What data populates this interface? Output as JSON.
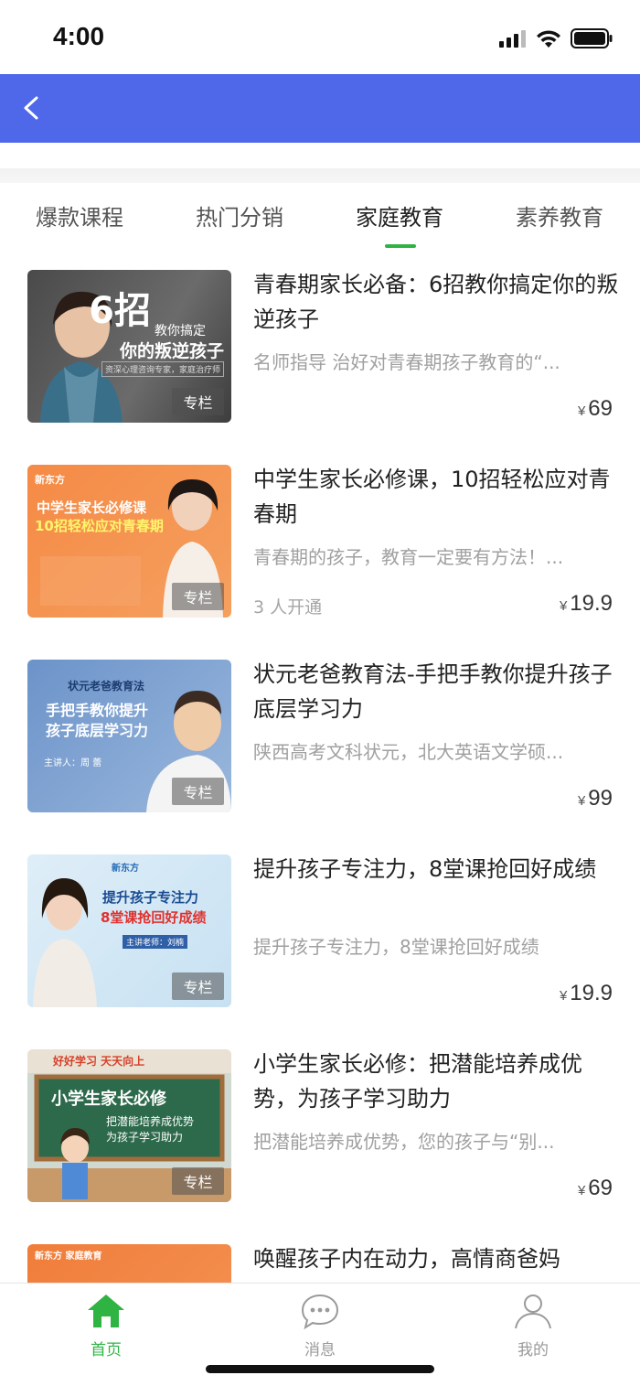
{
  "status": {
    "time": "4:00"
  },
  "tabs": [
    {
      "label": "爆款课程",
      "active": false
    },
    {
      "label": "热门分销",
      "active": false
    },
    {
      "label": "家庭教育",
      "active": true
    },
    {
      "label": "素养教育",
      "active": false
    }
  ],
  "courses": [
    {
      "title": "青春期家长必备：6招教你搞定你的叛逆孩子",
      "desc": "名师指导 治好对青春期孩子教育的“...",
      "price_symbol": "¥",
      "price": "69",
      "badge": "专栏",
      "thumb": {
        "big": "6招",
        "line1": "教你搞定",
        "line2": "你的叛逆孩子",
        "note": "资深心理咨询专家，家庭治疗师"
      }
    },
    {
      "title": "中学生家长必修课，10招轻松应对青春期",
      "desc": "青春期的孩子，教育一定要有方法！...",
      "subscribers": "3 人开通",
      "price_symbol": "¥",
      "price": "19.9",
      "badge": "专栏",
      "thumb": {
        "brand": "新东方",
        "line1": "中学生家长必修课",
        "line2": "10招轻松应对青春期"
      }
    },
    {
      "title": "状元老爸教育法-手把手教你提升孩子底层学习力",
      "desc": "陕西高考文科状元，北大英语文学硕...",
      "price_symbol": "¥",
      "price": "99",
      "badge": "专栏",
      "thumb": {
        "small": "状元老爸教育法",
        "line1": "手把手教你提升",
        "line2": "孩子底层学习力",
        "speaker": "主讲人：周 蕾"
      }
    },
    {
      "title": "提升孩子专注力，8堂课抢回好成绩",
      "desc": "提升孩子专注力，8堂课抢回好成绩",
      "price_symbol": "¥",
      "price": "19.9",
      "badge": "专栏",
      "thumb": {
        "brand": "新东方",
        "line1": "提升孩子专注力",
        "line2": "8堂课抢回好成绩",
        "speaker": "主讲老师：刘楠"
      }
    },
    {
      "title": "小学生家长必修：把潜能培养成优势，为孩子学习助力",
      "desc": "把潜能培养成优势，您的孩子与“别...",
      "price_symbol": "¥",
      "price": "69",
      "badge": "专栏",
      "thumb": {
        "banner": "好好学习 天天向上",
        "line1": "小学生家长必修",
        "line2": "把潜能培养成优势",
        "line3": "为孩子学习助力"
      }
    },
    {
      "title": "唤醒孩子内在动力，高情商爸妈",
      "thumb": {
        "brand": "新东方 家庭教育"
      }
    }
  ],
  "bottom_nav": [
    {
      "label": "首页",
      "icon": "home-icon",
      "active": true
    },
    {
      "label": "消息",
      "icon": "message-icon",
      "active": false
    },
    {
      "label": "我的",
      "icon": "profile-icon",
      "active": false
    }
  ],
  "colors": {
    "nav": "#4f68ea",
    "accent": "#2fb444"
  }
}
